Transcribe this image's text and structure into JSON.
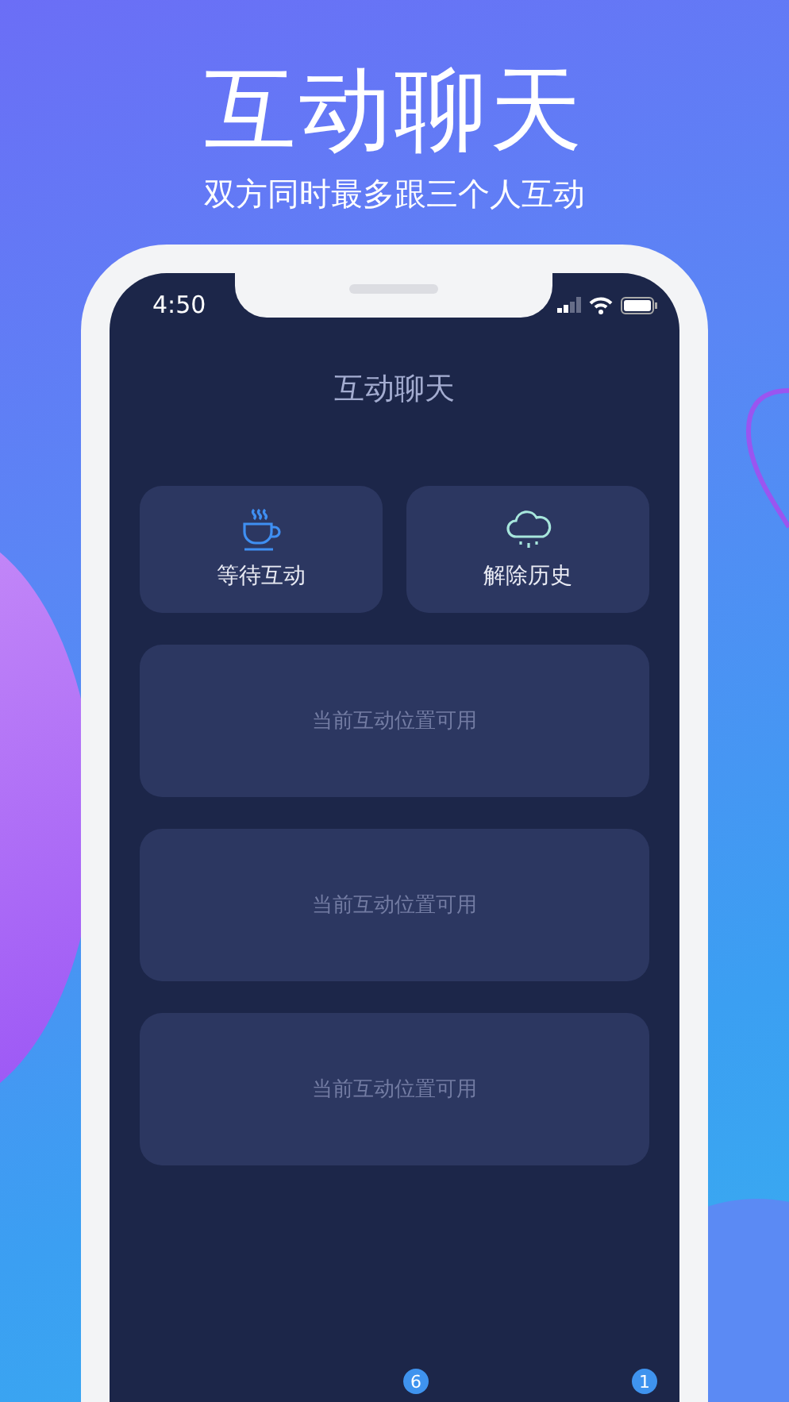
{
  "header": {
    "title": "互动聊天",
    "subtitle": "双方同时最多跟三个人互动"
  },
  "status_bar": {
    "time": "4:50"
  },
  "screen": {
    "title": "互动聊天"
  },
  "actions": [
    {
      "label": "等待互动",
      "kind": "cup"
    },
    {
      "label": "解除历史",
      "kind": "cloud"
    }
  ],
  "slots": [
    {
      "text": "当前互动位置可用"
    },
    {
      "text": "当前互动位置可用"
    },
    {
      "text": "当前互动位置可用"
    }
  ],
  "tab_badges": [
    "6",
    "1"
  ]
}
